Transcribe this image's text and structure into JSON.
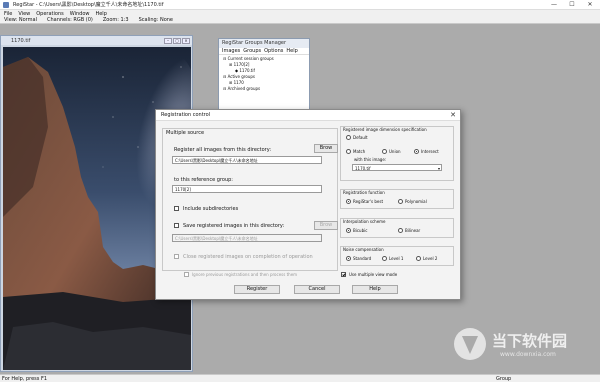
{
  "app": {
    "title": "RegiStar - C:\\Users\\黑影\\Desktop\\魔立千人\\未命名地址\\1170.tif",
    "window_controls": [
      "—",
      "☐",
      "✕"
    ]
  },
  "menu": [
    "File",
    "View",
    "Operations",
    "Window",
    "Help"
  ],
  "info_bar": {
    "view": "View: Normal",
    "channels": "Channels: RGB (0)",
    "zoom": "Zoom: 1:3",
    "scaling": "Scaling: None"
  },
  "image_window": {
    "title": "1170.tif",
    "buttons": [
      "–",
      "◻",
      "×"
    ]
  },
  "groups_manager": {
    "title": "RegiStar Groups Manager",
    "menu": [
      "Images",
      "Groups",
      "Options",
      "Help"
    ],
    "tree": [
      "Current session groups",
      "1170[2]",
      "1170.tif",
      "Active groups",
      "1170",
      "Archived groups"
    ]
  },
  "dialog": {
    "title": "Registration control",
    "close": "✕",
    "multiple_source_label": "Multiple source",
    "register_all_label": "Register all images from this directory:",
    "browse_label": "Brow",
    "directory_value": "C:\\Users\\黑影\\Desktop\\魔立千人\\未命名地址",
    "reference_group_label": "to this reference group:",
    "reference_group_value": "1170[2]",
    "include_subdirs_label": "Include subdirectories",
    "save_registered_label": "Save registered images in this directory:",
    "browse2_label": "Brow",
    "save_dir_value": "C:\\Users\\黑影\\Desktop\\魔立千人\\未命名地址",
    "close_registered_label": "Close registered images on completion of operation",
    "ignore_label": "Ignore previous registrations and then process them",
    "register_button": "Register",
    "cancel_button": "Cancel",
    "help_button": "Help",
    "use_multiple_view_label": "Use multiple view mode",
    "dimension": {
      "title": "Registered image dimension specification",
      "default_label": "Default",
      "match_label": "Match",
      "union_label": "Union",
      "intersect_label": "Intersect",
      "with_image_label": "with this image:",
      "with_image_value": "1170.tif"
    },
    "registration_function": {
      "title": "Registration function",
      "regiStar_best_label": "RegiStar's best",
      "polynomial_label": "Polynomial"
    },
    "interpolation": {
      "title": "Interpolation scheme",
      "bicubic_label": "Bicubic",
      "bilinear_label": "Bilinear"
    },
    "noise": {
      "title": "Noise compensation",
      "standard_label": "Standard",
      "level1_label": "Level 1",
      "level2_label": "Level 2"
    }
  },
  "watermark": {
    "brand": "当下软件园",
    "url": "www.downxia.com"
  },
  "status": {
    "left": "For Help, press F1",
    "right": "Group"
  }
}
